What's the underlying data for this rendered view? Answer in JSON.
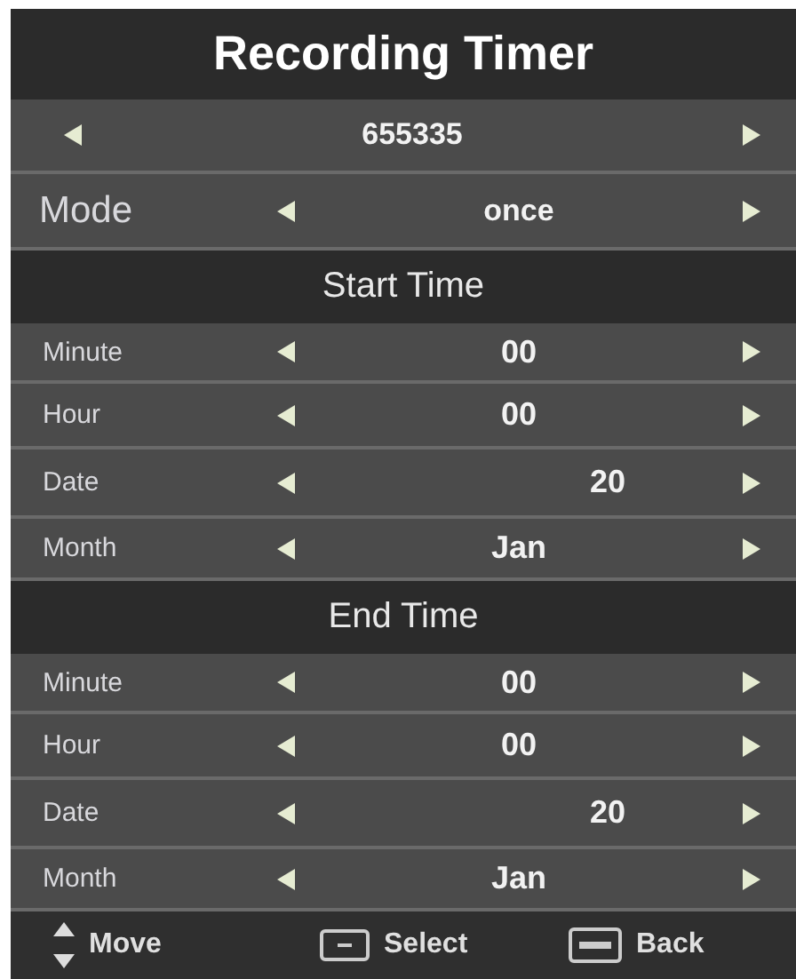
{
  "title": "Recording Timer",
  "channel": {
    "value": "655335"
  },
  "mode": {
    "label": "Mode",
    "value": "once"
  },
  "sections": [
    {
      "heading": "Start Time",
      "rows": [
        {
          "label": "Minute",
          "value": "00",
          "kind": "plain"
        },
        {
          "label": "Hour",
          "value": "00",
          "kind": "plain"
        },
        {
          "label": "Date",
          "value": "20",
          "kind": "date"
        },
        {
          "label": "Month",
          "value": "Jan",
          "kind": "plain"
        }
      ]
    },
    {
      "heading": "End Time",
      "rows": [
        {
          "label": "Minute",
          "value": "00",
          "kind": "plain"
        },
        {
          "label": "Hour",
          "value": "00",
          "kind": "plain"
        },
        {
          "label": "Date",
          "value": "20",
          "kind": "date"
        },
        {
          "label": "Month",
          "value": "Jan",
          "kind": "plain"
        }
      ]
    }
  ],
  "footer": [
    {
      "kind": "updown",
      "label": "Move"
    },
    {
      "kind": "ok",
      "label": "Select"
    },
    {
      "kind": "menu",
      "label": "Back"
    }
  ]
}
